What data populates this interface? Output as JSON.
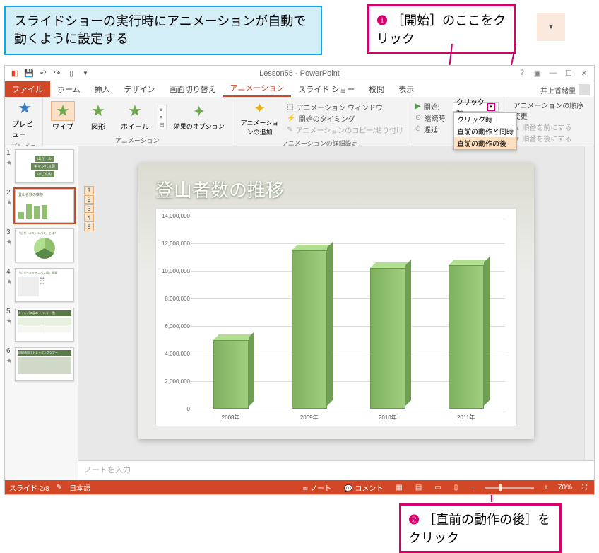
{
  "instruction_top": "スライドショーの実行時にアニメーションが自動で動くように設定する",
  "callout1": {
    "num": "❶",
    "text": "［開始］のここをクリック"
  },
  "callout2": {
    "num": "❷",
    "text": "［直前の動作の後］をクリック"
  },
  "window": {
    "title": "Lesson55 - PowerPoint",
    "user": "井上香緒里"
  },
  "tabs": {
    "file": "ファイル",
    "home": "ホーム",
    "insert": "挿入",
    "design": "デザイン",
    "transitions": "画面切り替え",
    "animations": "アニメーション",
    "slideshow": "スライド ショー",
    "review": "校閲",
    "view": "表示"
  },
  "ribbon": {
    "preview_group": "プレビュー",
    "preview_btn": "プレビュー",
    "anim_group": "アニメーション",
    "wipe": "ワイプ",
    "shape": "図形",
    "wheel": "ホイール",
    "effect_opt": "効果のオプション",
    "add_anim": "アニメーションの追加",
    "adv_group": "アニメーションの詳細設定",
    "anim_pane": "アニメーション ウィンドウ",
    "trigger": "開始のタイミング",
    "copy": "アニメーションのコピー/貼り付け",
    "timing_group": "タイミング",
    "start_lbl": "開始:",
    "start_val": "クリック時",
    "dur_lbl": "継続時",
    "dur_val": "",
    "delay_lbl": "遅延:",
    "delay_val": "",
    "dd_opt1": "クリック時",
    "dd_opt2": "直前の動作と同時",
    "dd_opt3": "直前の動作の後",
    "reorder_hdr": "アニメーションの順序変更",
    "reorder_up": "順番を前にする",
    "reorder_down": "順番を後にする"
  },
  "slide": {
    "title": "登山者数の推移",
    "anim_tags": [
      "1",
      "2",
      "3",
      "4",
      "5"
    ]
  },
  "chart_data": {
    "type": "bar",
    "categories": [
      "2008年",
      "2009年",
      "2010年",
      "2011年"
    ],
    "values": [
      5000000,
      11500000,
      10200000,
      10400000
    ],
    "title": "登山者数の推移",
    "xlabel": "",
    "ylabel": "",
    "ylim": [
      0,
      14000000
    ],
    "yticks": [
      0,
      2000000,
      4000000,
      6000000,
      8000000,
      10000000,
      12000000,
      14000000
    ],
    "ytick_labels": [
      "0",
      "2,000,000",
      "4,000,000",
      "6,000,000",
      "8,000,000",
      "10,000,000",
      "12,000,000",
      "14,000,000"
    ]
  },
  "notes_placeholder": "ノートを入力",
  "status": {
    "slide": "スライド 2/8",
    "lang": "日本語",
    "notes": "ノート",
    "comments": "コメント",
    "zoom": "70%"
  },
  "thumbs": {
    "t1a": "山ガール",
    "t1b": "キャンパス展",
    "t1c": "のご案内",
    "t2": "登山者数の推移",
    "t3": "「山ガールキャンパス」とは？",
    "t4": "「山ガールキャンパス展」概要",
    "t5": "キャンパス展のイベント一覧",
    "t6": "初級者向けトレッキングツアー"
  }
}
